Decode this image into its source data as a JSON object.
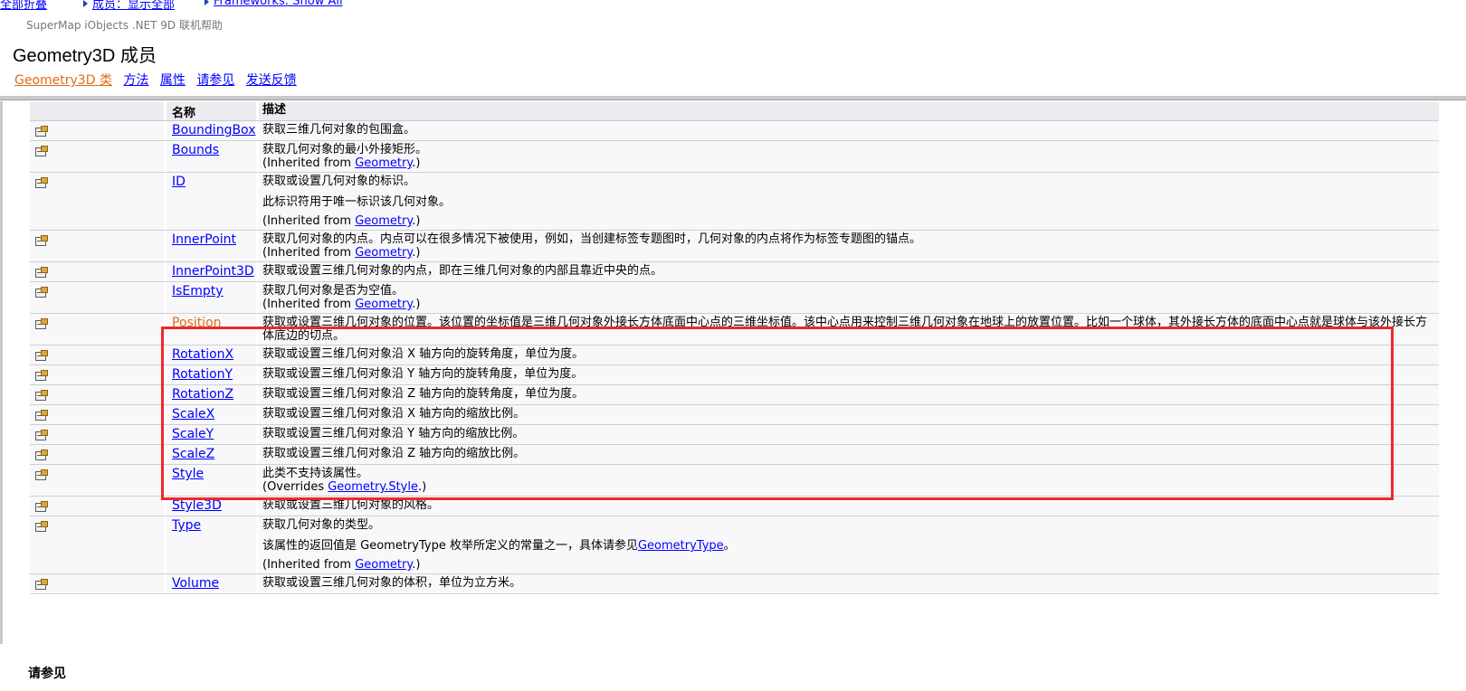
{
  "top_links": [
    {
      "label": "全部折叠"
    },
    {
      "label": "成员：显示全部"
    },
    {
      "label": "Frameworks: Show All"
    }
  ],
  "subtitle": "SuperMap iObjects .NET 9D 联机帮助",
  "page_title": "Geometry3D 成员",
  "nav_links": [
    "Geometry3D 类",
    "方法",
    "属性",
    "请参见",
    "发送反馈"
  ],
  "table": {
    "headers": {
      "name": "名称",
      "description": "描述"
    },
    "rows": [
      {
        "name": "BoundingBox",
        "desc": [
          "获取三维几何对象的包围盒。"
        ]
      },
      {
        "name": "Bounds",
        "desc": [
          "获取几何对象的最小外接矩形。"
        ],
        "inherit": {
          "prefix": "(Inherited from ",
          "link": "Geometry",
          "suffix": ".)"
        }
      },
      {
        "name": "ID",
        "desc": [
          "获取或设置几何对象的标识。",
          "此标识符用于唯一标识该几何对象。"
        ],
        "inherit": {
          "prefix": "(Inherited from ",
          "link": "Geometry",
          "suffix": ".)"
        }
      },
      {
        "name": "InnerPoint",
        "desc": [
          "获取几何对象的内点。内点可以在很多情况下被使用，例如，当创建标签专题图时，几何对象的内点将作为标签专题图的锚点。"
        ],
        "inherit": {
          "prefix": "(Inherited from ",
          "link": "Geometry",
          "suffix": ".)"
        }
      },
      {
        "name": "InnerPoint3D",
        "desc": [
          "获取或设置三维几何对象的内点，即在三维几何对象的内部且靠近中央的点。"
        ]
      },
      {
        "name": "IsEmpty",
        "desc": [
          "获取几何对象是否为空值。"
        ],
        "inherit": {
          "prefix": "(Inherited from ",
          "link": "Geometry",
          "suffix": ".)"
        }
      },
      {
        "name": "Position",
        "visited": true,
        "desc": [
          "获取或设置三维几何对象的位置。该位置的坐标值是三维几何对象外接长方体底面中心点的三维坐标值。该中心点用来控制三维几何对象在地球上的放置位置。比如一个球体，其外接长方体的底面中心点就是球体与该外接长方体底边的切点。"
        ]
      },
      {
        "name": "RotationX",
        "desc": [
          "获取或设置三维几何对象沿 X 轴方向的旋转角度，单位为度。"
        ]
      },
      {
        "name": "RotationY",
        "desc": [
          "获取或设置三维几何对象沿 Y 轴方向的旋转角度，单位为度。"
        ]
      },
      {
        "name": "RotationZ",
        "desc": [
          "获取或设置三维几何对象沿 Z 轴方向的旋转角度，单位为度。"
        ]
      },
      {
        "name": "ScaleX",
        "desc": [
          "获取或设置三维几何对象沿 X 轴方向的缩放比例。"
        ]
      },
      {
        "name": "ScaleY",
        "desc": [
          "获取或设置三维几何对象沿 Y 轴方向的缩放比例。"
        ]
      },
      {
        "name": "ScaleZ",
        "desc": [
          "获取或设置三维几何对象沿 Z 轴方向的缩放比例。"
        ]
      },
      {
        "name": "Style",
        "desc": [
          "此类不支持该属性。"
        ],
        "inherit": {
          "prefix": "(Overrides ",
          "link": "Geometry.Style",
          "suffix": ".)"
        }
      },
      {
        "name": "Style3D",
        "desc": [
          "获取或设置三维几何对象的风格。"
        ]
      },
      {
        "name": "Type",
        "desc": [
          "获取几何对象的类型。",
          "该属性的返回值是 GeometryType 枚举所定义的常量之一，具体请参见"
        ],
        "desc_link": "GeometryType",
        "desc_link_suffix": "。",
        "inherit": {
          "prefix": "(Inherited from ",
          "link": "Geometry",
          "suffix": ".)"
        }
      },
      {
        "name": "Volume",
        "desc": [
          "获取或设置三维几何对象的体积，单位为立方米。"
        ]
      }
    ]
  },
  "footer_heading": "请参见",
  "colors": {
    "link": "#0000ff",
    "visited_link": "#e06c1a",
    "highlight_border": "#ec2a2a",
    "header_bg": "#ebebf0"
  }
}
